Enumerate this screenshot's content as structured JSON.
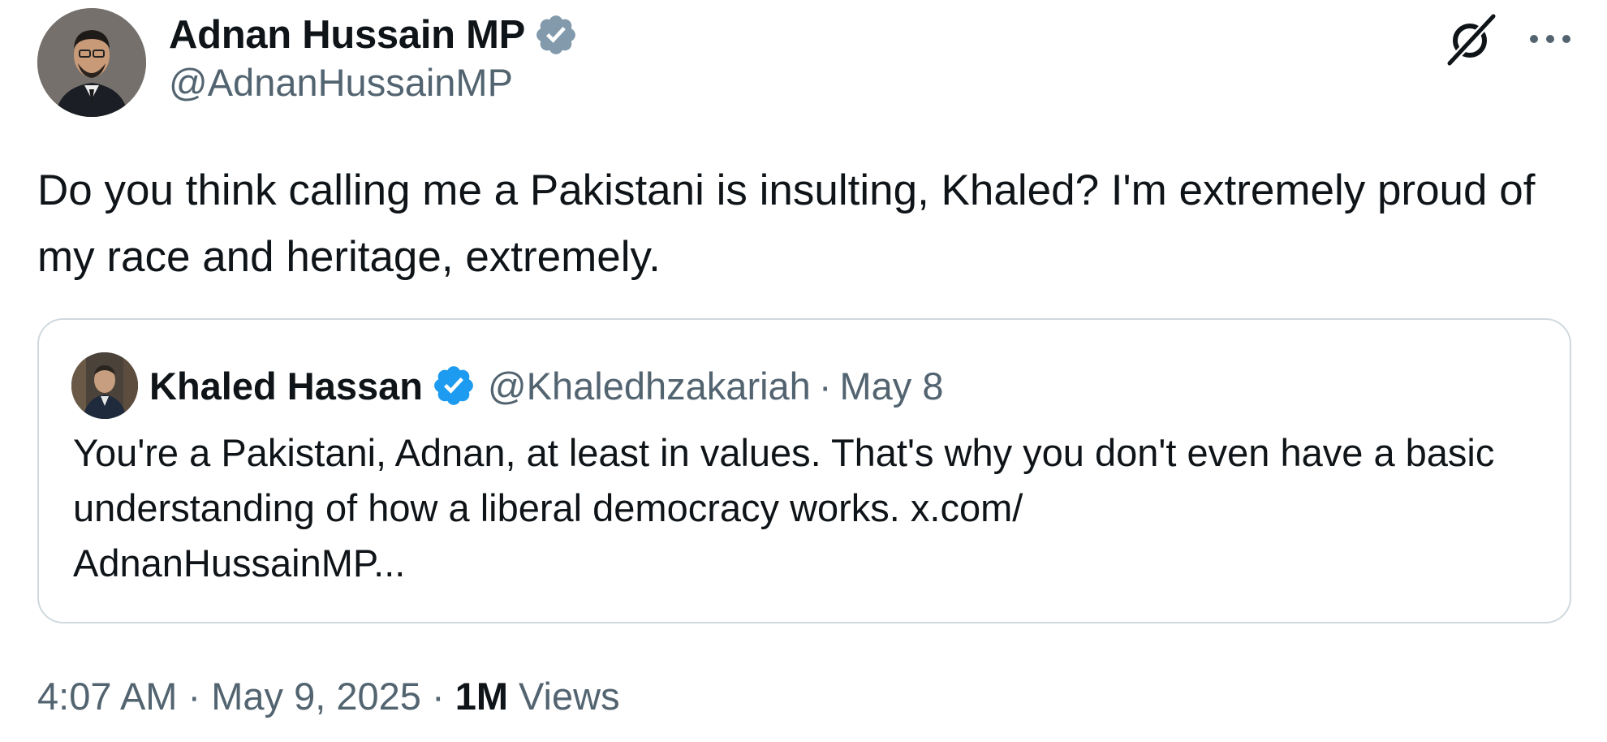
{
  "author": {
    "name": "Adnan Hussain MP",
    "handle": "@AdnanHussainMP",
    "verified": "grey"
  },
  "tweet": {
    "text": "Do you think calling me a Pakistani is insulting, Khaled? I'm extremely proud of my race and heritage, extremely."
  },
  "quote": {
    "name": "Khaled Hassan",
    "handle": "@Khaledhzakariah",
    "separator": "·",
    "date": "May 8",
    "verified": "blue",
    "text": "You're a Pakistani, Adnan, at least in values. That's why you don't even have a basic understanding of how a liberal democracy works. x.com/\nAdnanHussainMP..."
  },
  "meta": {
    "time": "4:07 AM",
    "sep1": " · ",
    "date": "May 9, 2025",
    "sep2": " · ",
    "views_count": "1M",
    "views_label": " Views"
  },
  "icons": {
    "top_right": [
      "grok-icon",
      "more-icon"
    ],
    "verified_grey_color": "#829aab",
    "verified_blue_color": "#1d9bf0"
  },
  "colors": {
    "text_primary": "#0f1419",
    "text_secondary": "#536471",
    "border": "#cfd9de"
  }
}
